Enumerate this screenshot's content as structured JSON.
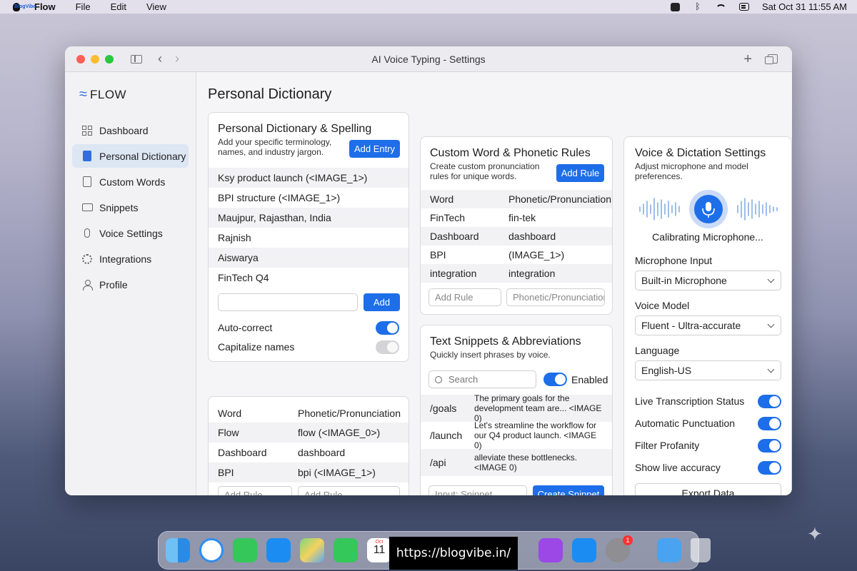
{
  "menubar": {
    "logo_text": "BlogVibe",
    "app": "Flow",
    "items": [
      "File",
      "Edit",
      "View"
    ],
    "clock": "Sat Oct 31  11:55 AM"
  },
  "window": {
    "title": "AI Voice Typing - Settings"
  },
  "sidebar": {
    "brand": "FLOW",
    "items": [
      {
        "label": "Dashboard",
        "icon": "grid-icon"
      },
      {
        "label": "Personal Dictionary",
        "icon": "book-icon",
        "active": true
      },
      {
        "label": "Custom Words",
        "icon": "document-icon"
      },
      {
        "label": "Snippets",
        "icon": "folder-icon"
      },
      {
        "label": "Voice Settings",
        "icon": "microphone-icon"
      },
      {
        "label": "Integrations",
        "icon": "gear-icon"
      },
      {
        "label": "Profile",
        "icon": "user-icon"
      }
    ]
  },
  "main": {
    "page_title": "Personal Dictionary"
  },
  "dictionary": {
    "title": "Personal Dictionary & Spelling",
    "subtitle": "Add your specific terminology, names, and industry jargon.",
    "add_entry_label": "Add Entry",
    "entries": [
      "Ksy product launch (<IMAGE_1>)",
      "BPI structure (<IMAGE_1>)",
      "Maujpur, Rajasthan, India",
      "Rajnish",
      "Aiswarya",
      "FinTech Q4"
    ],
    "input_value": "",
    "add_label": "Add",
    "auto_correct_label": "Auto-correct",
    "auto_correct_on": true,
    "capitalize_label": "Capitalize names",
    "capitalize_on": false
  },
  "phonetic_table": {
    "headers": [
      "Word",
      "Phonetic/Pronunciation"
    ],
    "rows": [
      [
        "Flow",
        "flow (<IMAGE_0>)"
      ],
      [
        "Dashboard",
        "dashboard"
      ],
      [
        "BPI",
        "bpi (<IMAGE_1>)"
      ]
    ],
    "add_rule_placeholder_1": "Add Rule",
    "add_rule_placeholder_2": "Add Rule"
  },
  "custom_words": {
    "title": "Custom Word & Phonetic Rules",
    "subtitle": "Create custom pronunciation rules for unique words.",
    "add_rule_label": "Add Rule",
    "headers": [
      "Word",
      "Phonetic/Pronunciation"
    ],
    "rows": [
      [
        "FinTech",
        "fin-tek"
      ],
      [
        "Dashboard",
        "dashboard"
      ],
      [
        "BPI",
        "(IMAGE_1>)"
      ],
      [
        "integration",
        "integration"
      ]
    ],
    "add_rule_placeholder": "Add Rule",
    "phonetic_placeholder": "Phonetic/Pronunciation"
  },
  "snippets": {
    "title": "Text Snippets & Abbreviations",
    "subtitle": "Quickly insert phrases by voice.",
    "search_placeholder": "Search",
    "enabled_label": "Enabled",
    "enabled_on": true,
    "items": [
      {
        "key": "/goals",
        "text": "The primary goals for the development team are... <IMAGE 0)"
      },
      {
        "key": "/launch",
        "text": "Let's streamline the workflow for our Q4 product launch. <IMAGE 0)"
      },
      {
        "key": "/api",
        "text": "alleviate these bottlenecks. <IMAGE 0)"
      }
    ],
    "input_placeholder": "Input: Snippet",
    "create_label": "Create Snippet"
  },
  "voice": {
    "title": "Voice & Dictation Settings",
    "subtitle": "Adjust microphone and model preferences.",
    "status": "Calibrating Microphone...",
    "mic_input_label": "Microphone Input",
    "mic_input_value": "Built-in Microphone",
    "model_label": "Voice Model",
    "model_value": "Fluent - Ultra-accurate",
    "language_label": "Language",
    "language_value": "English-US",
    "toggles": [
      {
        "label": "Live Transcription Status",
        "on": true
      },
      {
        "label": "Automatic Punctuation",
        "on": true
      },
      {
        "label": "Filter Profanity",
        "on": true
      },
      {
        "label": "Show live accuracy",
        "on": true
      }
    ],
    "export_label": "Export Data"
  },
  "dock": {
    "calendar_month": "Oct",
    "calendar_day": "11",
    "settings_badge": "1",
    "url_overlay": "https://blogvibe.in/"
  },
  "colors": {
    "accent": "#1d6ee8",
    "sidebar_active": "#dde6f3"
  }
}
